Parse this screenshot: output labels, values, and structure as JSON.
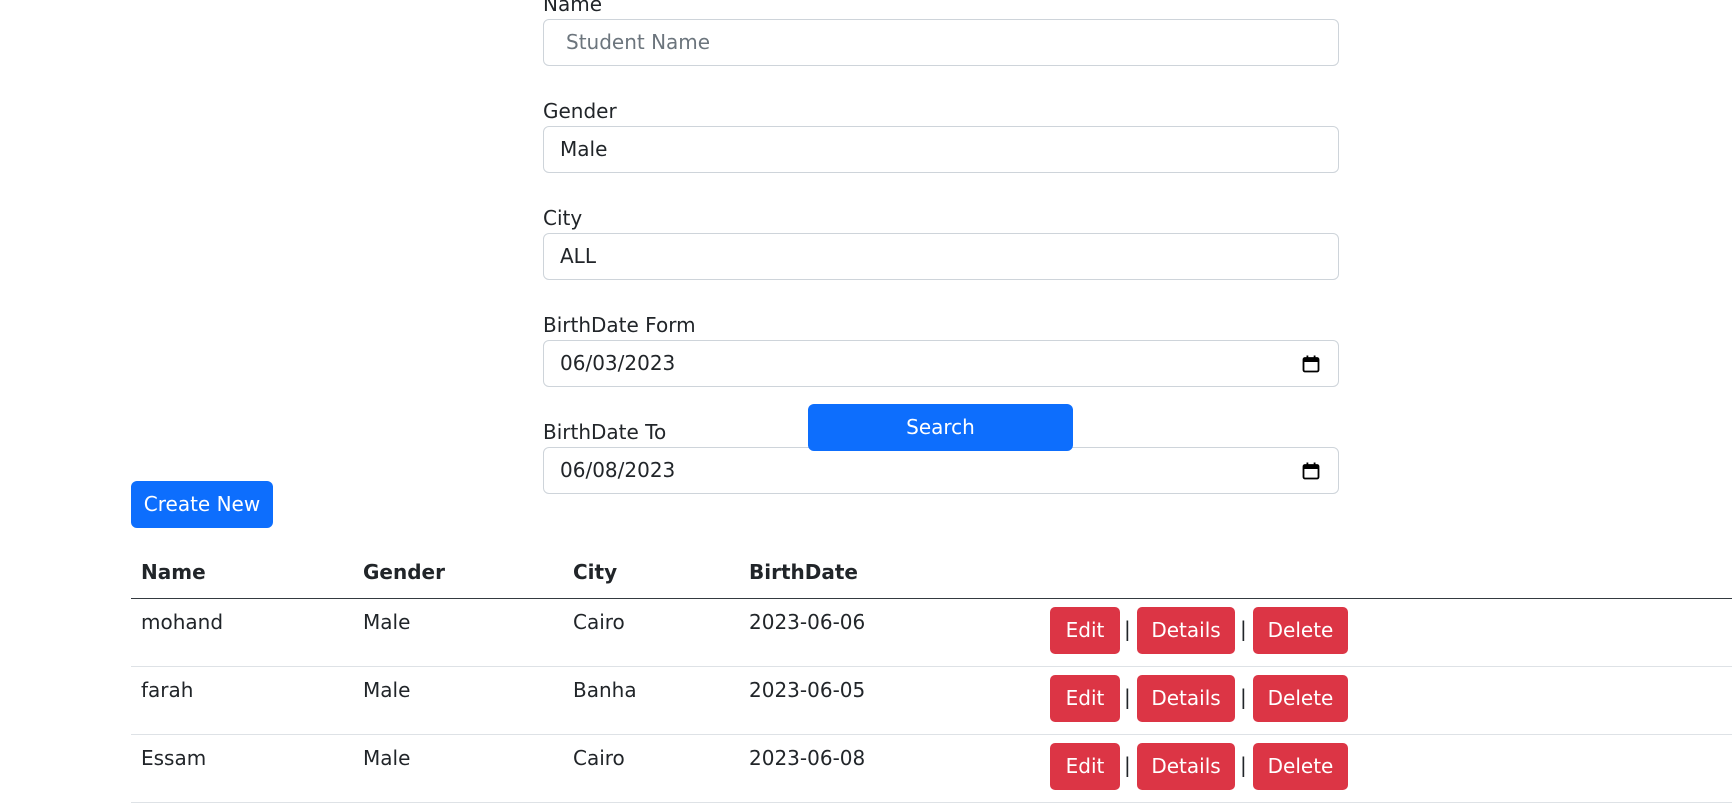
{
  "form": {
    "name_label": "Name",
    "name_placeholder": "Student Name",
    "gender_label": "Gender",
    "gender_value": "Male",
    "city_label": "City",
    "city_value": "ALL",
    "birth_from_label": "BirthDate Form",
    "birth_from_value": "06/03/2023",
    "birth_to_label": "BirthDate To",
    "birth_to_value": "06/08/2023",
    "search_label": "Search"
  },
  "create_label": "Create New",
  "table": {
    "headers": [
      "Name",
      "Gender",
      "City",
      "BirthDate"
    ],
    "separator": "|",
    "rows": [
      {
        "name": "mohand",
        "gender": "Male",
        "city": "Cairo",
        "birthdate": "2023-06-06",
        "edit": "Edit",
        "details": "Details",
        "delete": "Delete"
      },
      {
        "name": "farah",
        "gender": "Male",
        "city": "Banha",
        "birthdate": "2023-06-05",
        "edit": "Edit",
        "details": "Details",
        "delete": "Delete"
      },
      {
        "name": "Essam",
        "gender": "Male",
        "city": "Cairo",
        "birthdate": "2023-06-08",
        "edit": "Edit",
        "details": "Details",
        "delete": "Delete"
      }
    ]
  },
  "colors": {
    "primary": "#0d6efd",
    "danger": "#dc3545",
    "input_border": "#ced4da",
    "placeholder": "#6c757d"
  },
  "icons": {
    "date_picker": "calendar-icon"
  }
}
